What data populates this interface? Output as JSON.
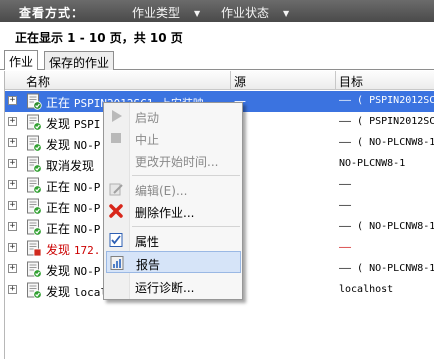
{
  "toolbar": {
    "view_label": "查看方式：",
    "job_type": "作业类型",
    "job_status": "作业状态"
  },
  "status_line": "正在显示 1 - 10 页，共 10 页",
  "tabs": [
    {
      "label": "作业"
    },
    {
      "label": "保存的作业"
    }
  ],
  "columns": {
    "name": "名称",
    "source": "源",
    "target": "目标"
  },
  "rows": [
    {
      "name_prefix": "正在",
      "name_rest": "PSPIN2012SC1 上安装映...",
      "source": "—",
      "target": "—— ( PSPIN2012SC",
      "state": "running"
    },
    {
      "name_prefix": "发现",
      "name_rest": "PSPI",
      "source": "",
      "target": "—— ( PSPIN2012SC",
      "state": "ok"
    },
    {
      "name_prefix": "发现",
      "name_rest": "NO-P",
      "source": "",
      "target": "—— ( NO-PLCNW8-1",
      "state": "ok"
    },
    {
      "name_prefix": "取消发现",
      "name_rest": "",
      "source": "",
      "target": "NO-PLCNW8-1",
      "state": "ok"
    },
    {
      "name_prefix": "正在",
      "name_rest": "NO-P",
      "source": "",
      "target": "——",
      "state": "ok"
    },
    {
      "name_prefix": "正在",
      "name_rest": "NO-P",
      "source": "",
      "target": "——",
      "state": "ok"
    },
    {
      "name_prefix": "正在",
      "name_rest": "NO-P",
      "source": "",
      "target": "—— ( NO-PLCNW8-1",
      "state": "ok"
    },
    {
      "name_prefix": "发现",
      "name_rest": "172.",
      "source": "",
      "target": "——",
      "state": "error"
    },
    {
      "name_prefix": "发现",
      "name_rest": "NO-P",
      "source": "",
      "target": "—— ( NO-PLCNW8-1",
      "state": "ok"
    },
    {
      "name_prefix": "发现",
      "name_rest": "local",
      "source": "",
      "target": "localhost",
      "state": "ok"
    }
  ],
  "context_menu": {
    "start": "启动",
    "stop": "中止",
    "change_start_time": "更改开始时间...",
    "edit": "编辑(E)...",
    "delete": "删除作业...",
    "properties": "属性",
    "report": "报告",
    "run_diagnostics": "运行诊断..."
  },
  "colors": {
    "selection": "#3b73e0",
    "toolbar": "#5a5a5a",
    "error_text": "#cc0000",
    "menu_hover": "#d6e4f8"
  }
}
